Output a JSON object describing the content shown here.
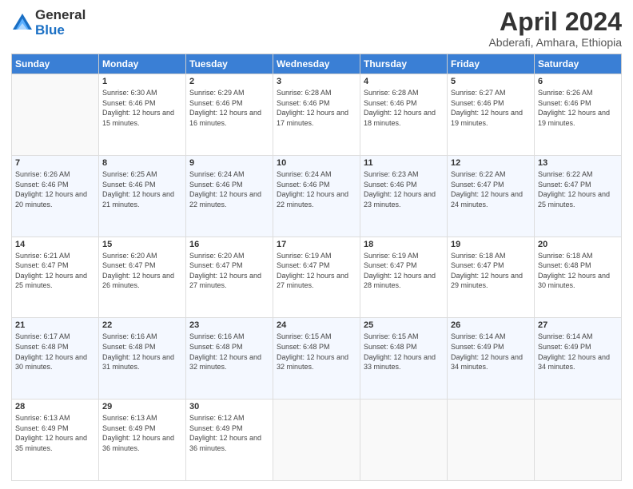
{
  "header": {
    "logo_general": "General",
    "logo_blue": "Blue",
    "month_title": "April 2024",
    "subtitle": "Abderafi, Amhara, Ethiopia"
  },
  "days_of_week": [
    "Sunday",
    "Monday",
    "Tuesday",
    "Wednesday",
    "Thursday",
    "Friday",
    "Saturday"
  ],
  "weeks": [
    [
      {
        "day": "",
        "sunrise": "",
        "sunset": "",
        "daylight": ""
      },
      {
        "day": "1",
        "sunrise": "Sunrise: 6:30 AM",
        "sunset": "Sunset: 6:46 PM",
        "daylight": "Daylight: 12 hours and 15 minutes."
      },
      {
        "day": "2",
        "sunrise": "Sunrise: 6:29 AM",
        "sunset": "Sunset: 6:46 PM",
        "daylight": "Daylight: 12 hours and 16 minutes."
      },
      {
        "day": "3",
        "sunrise": "Sunrise: 6:28 AM",
        "sunset": "Sunset: 6:46 PM",
        "daylight": "Daylight: 12 hours and 17 minutes."
      },
      {
        "day": "4",
        "sunrise": "Sunrise: 6:28 AM",
        "sunset": "Sunset: 6:46 PM",
        "daylight": "Daylight: 12 hours and 18 minutes."
      },
      {
        "day": "5",
        "sunrise": "Sunrise: 6:27 AM",
        "sunset": "Sunset: 6:46 PM",
        "daylight": "Daylight: 12 hours and 19 minutes."
      },
      {
        "day": "6",
        "sunrise": "Sunrise: 6:26 AM",
        "sunset": "Sunset: 6:46 PM",
        "daylight": "Daylight: 12 hours and 19 minutes."
      }
    ],
    [
      {
        "day": "7",
        "sunrise": "Sunrise: 6:26 AM",
        "sunset": "Sunset: 6:46 PM",
        "daylight": "Daylight: 12 hours and 20 minutes."
      },
      {
        "day": "8",
        "sunrise": "Sunrise: 6:25 AM",
        "sunset": "Sunset: 6:46 PM",
        "daylight": "Daylight: 12 hours and 21 minutes."
      },
      {
        "day": "9",
        "sunrise": "Sunrise: 6:24 AM",
        "sunset": "Sunset: 6:46 PM",
        "daylight": "Daylight: 12 hours and 22 minutes."
      },
      {
        "day": "10",
        "sunrise": "Sunrise: 6:24 AM",
        "sunset": "Sunset: 6:46 PM",
        "daylight": "Daylight: 12 hours and 22 minutes."
      },
      {
        "day": "11",
        "sunrise": "Sunrise: 6:23 AM",
        "sunset": "Sunset: 6:46 PM",
        "daylight": "Daylight: 12 hours and 23 minutes."
      },
      {
        "day": "12",
        "sunrise": "Sunrise: 6:22 AM",
        "sunset": "Sunset: 6:47 PM",
        "daylight": "Daylight: 12 hours and 24 minutes."
      },
      {
        "day": "13",
        "sunrise": "Sunrise: 6:22 AM",
        "sunset": "Sunset: 6:47 PM",
        "daylight": "Daylight: 12 hours and 25 minutes."
      }
    ],
    [
      {
        "day": "14",
        "sunrise": "Sunrise: 6:21 AM",
        "sunset": "Sunset: 6:47 PM",
        "daylight": "Daylight: 12 hours and 25 minutes."
      },
      {
        "day": "15",
        "sunrise": "Sunrise: 6:20 AM",
        "sunset": "Sunset: 6:47 PM",
        "daylight": "Daylight: 12 hours and 26 minutes."
      },
      {
        "day": "16",
        "sunrise": "Sunrise: 6:20 AM",
        "sunset": "Sunset: 6:47 PM",
        "daylight": "Daylight: 12 hours and 27 minutes."
      },
      {
        "day": "17",
        "sunrise": "Sunrise: 6:19 AM",
        "sunset": "Sunset: 6:47 PM",
        "daylight": "Daylight: 12 hours and 27 minutes."
      },
      {
        "day": "18",
        "sunrise": "Sunrise: 6:19 AM",
        "sunset": "Sunset: 6:47 PM",
        "daylight": "Daylight: 12 hours and 28 minutes."
      },
      {
        "day": "19",
        "sunrise": "Sunrise: 6:18 AM",
        "sunset": "Sunset: 6:47 PM",
        "daylight": "Daylight: 12 hours and 29 minutes."
      },
      {
        "day": "20",
        "sunrise": "Sunrise: 6:18 AM",
        "sunset": "Sunset: 6:48 PM",
        "daylight": "Daylight: 12 hours and 30 minutes."
      }
    ],
    [
      {
        "day": "21",
        "sunrise": "Sunrise: 6:17 AM",
        "sunset": "Sunset: 6:48 PM",
        "daylight": "Daylight: 12 hours and 30 minutes."
      },
      {
        "day": "22",
        "sunrise": "Sunrise: 6:16 AM",
        "sunset": "Sunset: 6:48 PM",
        "daylight": "Daylight: 12 hours and 31 minutes."
      },
      {
        "day": "23",
        "sunrise": "Sunrise: 6:16 AM",
        "sunset": "Sunset: 6:48 PM",
        "daylight": "Daylight: 12 hours and 32 minutes."
      },
      {
        "day": "24",
        "sunrise": "Sunrise: 6:15 AM",
        "sunset": "Sunset: 6:48 PM",
        "daylight": "Daylight: 12 hours and 32 minutes."
      },
      {
        "day": "25",
        "sunrise": "Sunrise: 6:15 AM",
        "sunset": "Sunset: 6:48 PM",
        "daylight": "Daylight: 12 hours and 33 minutes."
      },
      {
        "day": "26",
        "sunrise": "Sunrise: 6:14 AM",
        "sunset": "Sunset: 6:49 PM",
        "daylight": "Daylight: 12 hours and 34 minutes."
      },
      {
        "day": "27",
        "sunrise": "Sunrise: 6:14 AM",
        "sunset": "Sunset: 6:49 PM",
        "daylight": "Daylight: 12 hours and 34 minutes."
      }
    ],
    [
      {
        "day": "28",
        "sunrise": "Sunrise: 6:13 AM",
        "sunset": "Sunset: 6:49 PM",
        "daylight": "Daylight: 12 hours and 35 minutes."
      },
      {
        "day": "29",
        "sunrise": "Sunrise: 6:13 AM",
        "sunset": "Sunset: 6:49 PM",
        "daylight": "Daylight: 12 hours and 36 minutes."
      },
      {
        "day": "30",
        "sunrise": "Sunrise: 6:12 AM",
        "sunset": "Sunset: 6:49 PM",
        "daylight": "Daylight: 12 hours and 36 minutes."
      },
      {
        "day": "",
        "sunrise": "",
        "sunset": "",
        "daylight": ""
      },
      {
        "day": "",
        "sunrise": "",
        "sunset": "",
        "daylight": ""
      },
      {
        "day": "",
        "sunrise": "",
        "sunset": "",
        "daylight": ""
      },
      {
        "day": "",
        "sunrise": "",
        "sunset": "",
        "daylight": ""
      }
    ]
  ]
}
